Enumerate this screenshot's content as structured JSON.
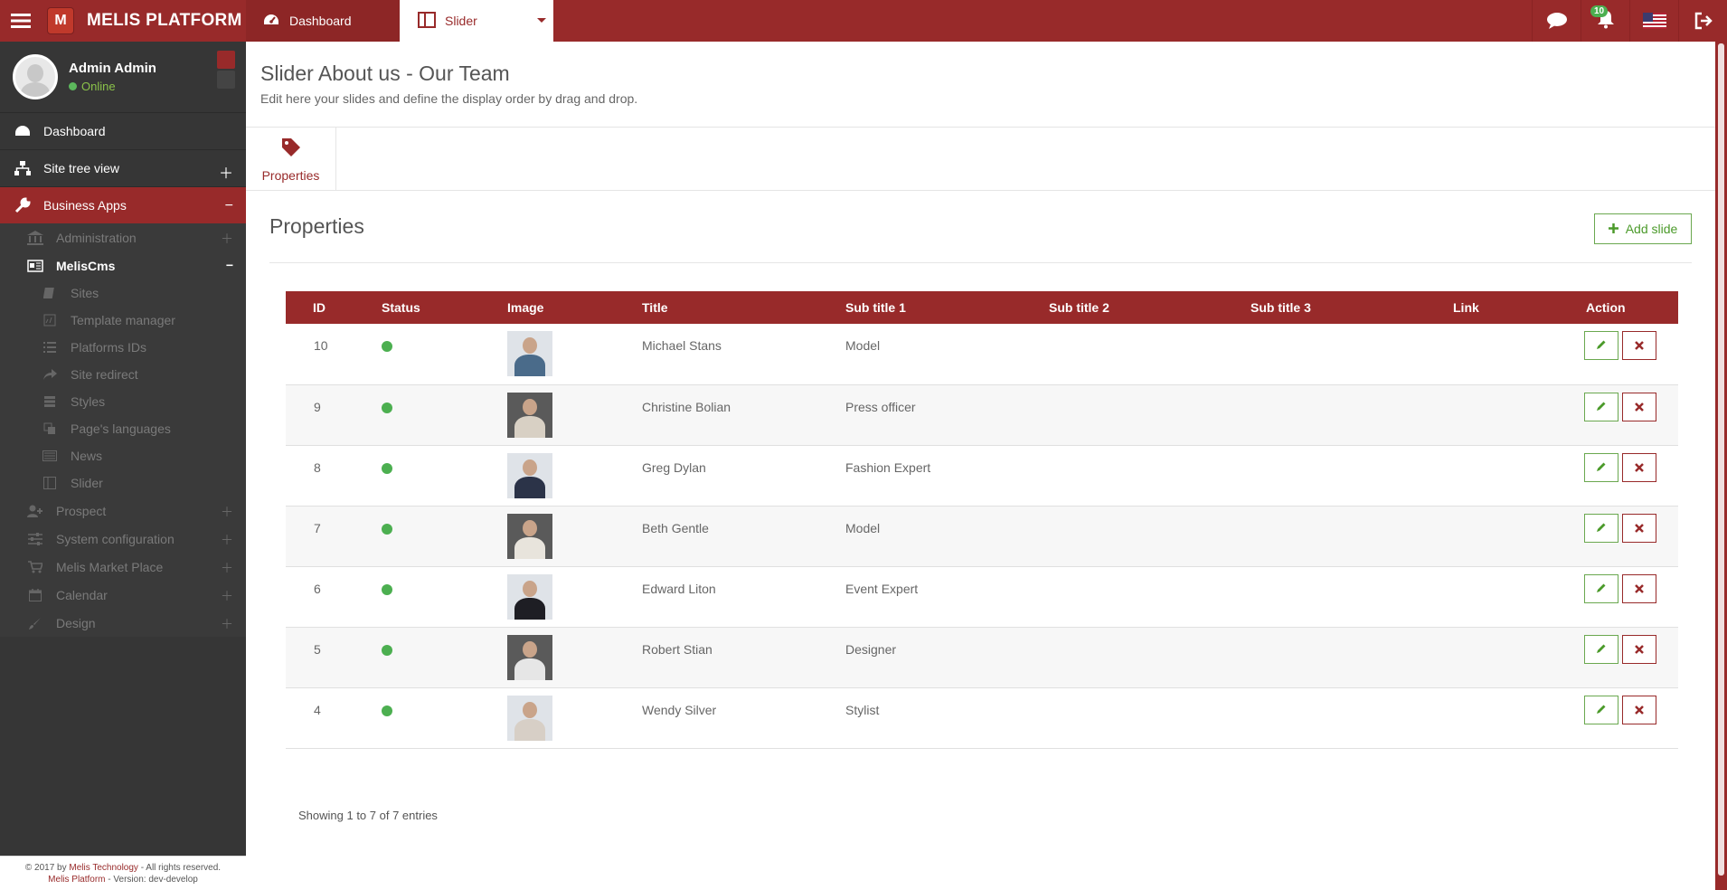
{
  "topbar": {
    "brand": "MELIS PLATFORM",
    "logo_letter": "M",
    "tabs": [
      {
        "label": "Dashboard"
      },
      {
        "label": "Slider"
      }
    ],
    "notification_count": "10",
    "accent": "#982a2a"
  },
  "sidebar": {
    "user_name": "Admin Admin",
    "user_status": "Online",
    "items": {
      "dashboard": "Dashboard",
      "site_tree": "Site tree view",
      "business_apps": "Business Apps",
      "administration": "Administration",
      "meliscms": "MelisCms",
      "sites": "Sites",
      "template_manager": "Template manager",
      "platforms_ids": "Platforms IDs",
      "site_redirect": "Site redirect",
      "styles": "Styles",
      "page_languages": "Page's languages",
      "news": "News",
      "slider": "Slider",
      "prospect": "Prospect",
      "system_config": "System configuration",
      "market_place": "Melis Market Place",
      "calendar": "Calendar",
      "design": "Design"
    },
    "footer_line1_a": "© 2017 by ",
    "footer_line1_b": "Melis Technology",
    "footer_line1_c": " - All rights reserved.",
    "footer_line2_a": "Melis Platform",
    "footer_line2_b": " - Version: dev-develop"
  },
  "main": {
    "title": "Slider About us - Our Team",
    "subtitle": "Edit here your slides and define the display order by drag and drop.",
    "tab_properties": "Properties",
    "section_title": "Properties",
    "add_slide": "Add slide",
    "columns": [
      "ID",
      "Status",
      "Image",
      "Title",
      "Sub title 1",
      "Sub title 2",
      "Sub title 3",
      "Link",
      "Action"
    ],
    "rows": [
      {
        "id": "10",
        "title": "Michael Stans",
        "sub1": "Model",
        "sub2": "",
        "sub3": "",
        "link": "",
        "shirt": "#4a6b8a"
      },
      {
        "id": "9",
        "title": "Christine Bolian",
        "sub1": "Press officer",
        "sub2": "",
        "sub3": "",
        "link": "",
        "shirt": "#d8d0c4"
      },
      {
        "id": "8",
        "title": "Greg Dylan",
        "sub1": "Fashion Expert",
        "sub2": "",
        "sub3": "",
        "link": "",
        "shirt": "#2b3348"
      },
      {
        "id": "7",
        "title": "Beth Gentle",
        "sub1": "Model",
        "sub2": "",
        "sub3": "",
        "link": "",
        "shirt": "#e8e4dc"
      },
      {
        "id": "6",
        "title": "Edward Liton",
        "sub1": "Event Expert",
        "sub2": "",
        "sub3": "",
        "link": "",
        "shirt": "#1e1e24"
      },
      {
        "id": "5",
        "title": "Robert Stian",
        "sub1": "Designer",
        "sub2": "",
        "sub3": "",
        "link": "",
        "shirt": "#e6e6e6"
      },
      {
        "id": "4",
        "title": "Wendy Silver",
        "sub1": "Stylist",
        "sub2": "",
        "sub3": "",
        "link": "",
        "shirt": "#d7cfc6"
      }
    ],
    "entries_text": "Showing 1 to 7 of 7 entries"
  }
}
